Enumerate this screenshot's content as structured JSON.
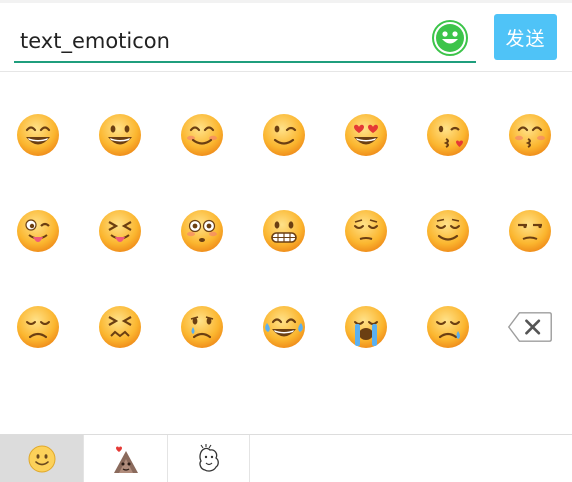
{
  "input": {
    "value": "text_emoticon"
  },
  "send_button": {
    "label": "发送"
  },
  "colors": {
    "accent_underline": "#1f9e7d",
    "send_button_bg": "#4fc3f7",
    "toggle_green": "#3cc44a",
    "emoji_face": "#fbb62f"
  },
  "emoji_grid": {
    "rows": [
      [
        "grinning-face-icon",
        "smiley-face-icon",
        "blush-face-icon",
        "wink-face-icon",
        "heart-eyes-face-icon",
        "kissing-heart-face-icon",
        "kissing-closed-eyes-face-icon"
      ],
      [
        "stuck-out-tongue-winking-face-icon",
        "stuck-out-tongue-closed-eyes-face-icon",
        "flushed-face-icon",
        "grimacing-face-icon",
        "pensive-face-icon",
        "relieved-face-icon",
        "unamused-face-icon"
      ],
      [
        "disappointed-face-icon",
        "confounded-face-icon",
        "crying-face-icon",
        "joy-face-icon",
        "sob-face-icon",
        "sleepy-face-icon",
        "backspace-icon"
      ]
    ]
  },
  "tabs": [
    {
      "icon": "smiley-tab-icon",
      "selected": true
    },
    {
      "icon": "sticker-pack-icon",
      "selected": false
    },
    {
      "icon": "sticker-sketch-icon",
      "selected": false
    }
  ]
}
